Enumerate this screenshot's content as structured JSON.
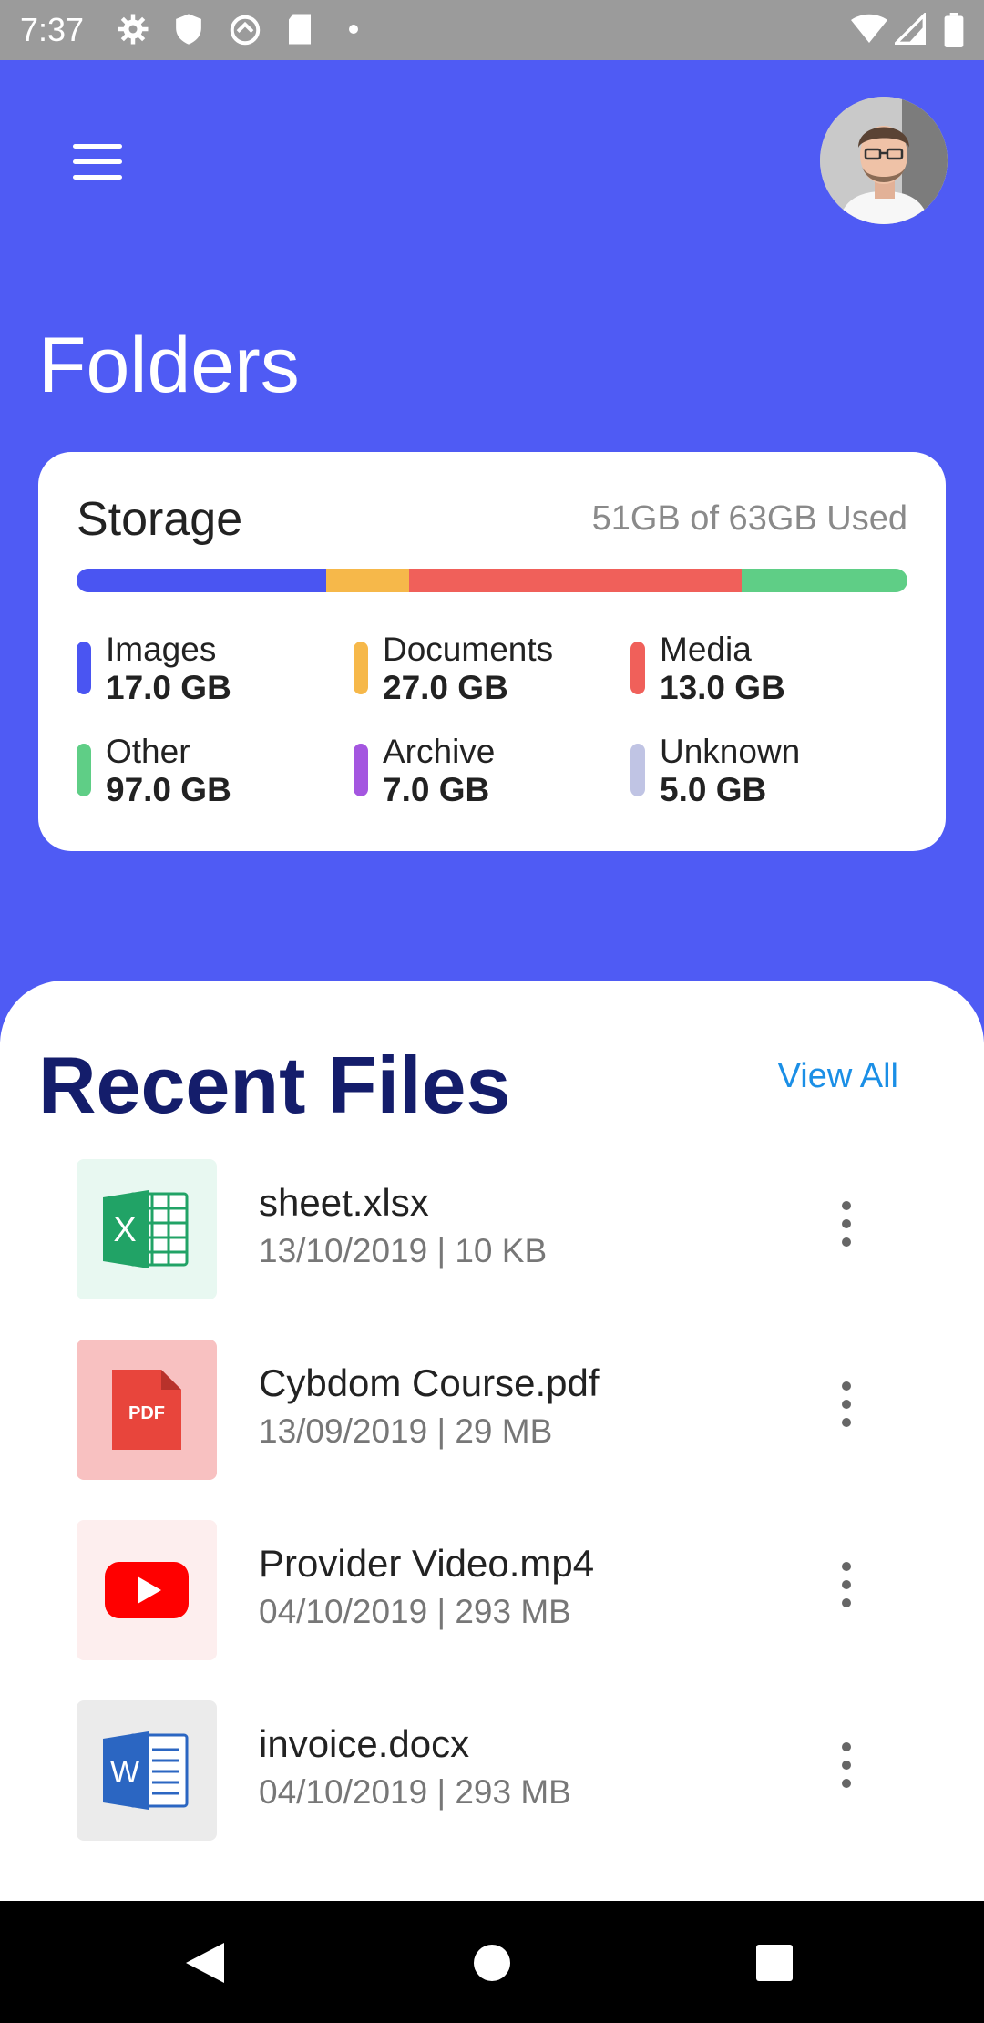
{
  "status_bar": {
    "time": "7:37",
    "icons_left": [
      "settings-icon",
      "shield-icon",
      "sync-icon",
      "sd-card-icon",
      "dot-icon"
    ],
    "icons_right": [
      "wifi-icon",
      "signal-icon",
      "battery-icon"
    ]
  },
  "header": {
    "menu_icon": "hamburger-menu-icon",
    "avatar": "user-avatar",
    "title": "Folders"
  },
  "storage": {
    "title": "Storage",
    "usage": "51GB of 63GB Used",
    "bar_segments": [
      {
        "name": "Images",
        "fraction": 0.3,
        "color": "#4a55f2"
      },
      {
        "name": "Documents",
        "fraction": 0.1,
        "color": "#f6b84a"
      },
      {
        "name": "Media",
        "fraction": 0.4,
        "color": "#f0605a"
      },
      {
        "name": "Other",
        "fraction": 0.2,
        "color": "#5fce86"
      }
    ],
    "items": [
      {
        "label": "Images",
        "value": "17.0 GB",
        "color": "#4a55f2"
      },
      {
        "label": "Documents",
        "value": "27.0 GB",
        "color": "#f6b84a"
      },
      {
        "label": "Media",
        "value": "13.0 GB",
        "color": "#f0605a"
      },
      {
        "label": "Other",
        "value": "97.0 GB",
        "color": "#5fce86"
      },
      {
        "label": "Archive",
        "value": "7.0 GB",
        "color": "#a456e0"
      },
      {
        "label": "Unknown",
        "value": "5.0 GB",
        "color": "#c0c4e4"
      }
    ]
  },
  "recent": {
    "title": "Recent Files",
    "view_all": "View All",
    "files": [
      {
        "name": "sheet.xlsx",
        "meta": "13/10/2019 | 10 KB",
        "icon": "excel-icon",
        "bg": "#e8f8f1"
      },
      {
        "name": "Cybdom Course.pdf",
        "meta": "13/09/2019 | 29 MB",
        "icon": "pdf-icon",
        "bg": "#f8c1c1",
        "icon_text": "PDF"
      },
      {
        "name": "Provider Video.mp4",
        "meta": "04/10/2019 | 293 MB",
        "icon": "youtube-icon",
        "bg": "#fdeeee"
      },
      {
        "name": "invoice.docx",
        "meta": "04/10/2019 | 293 MB",
        "icon": "word-icon",
        "bg": "#ebebeb"
      }
    ]
  },
  "nav": {
    "buttons": [
      "back-icon",
      "home-icon",
      "recents-icon"
    ]
  }
}
